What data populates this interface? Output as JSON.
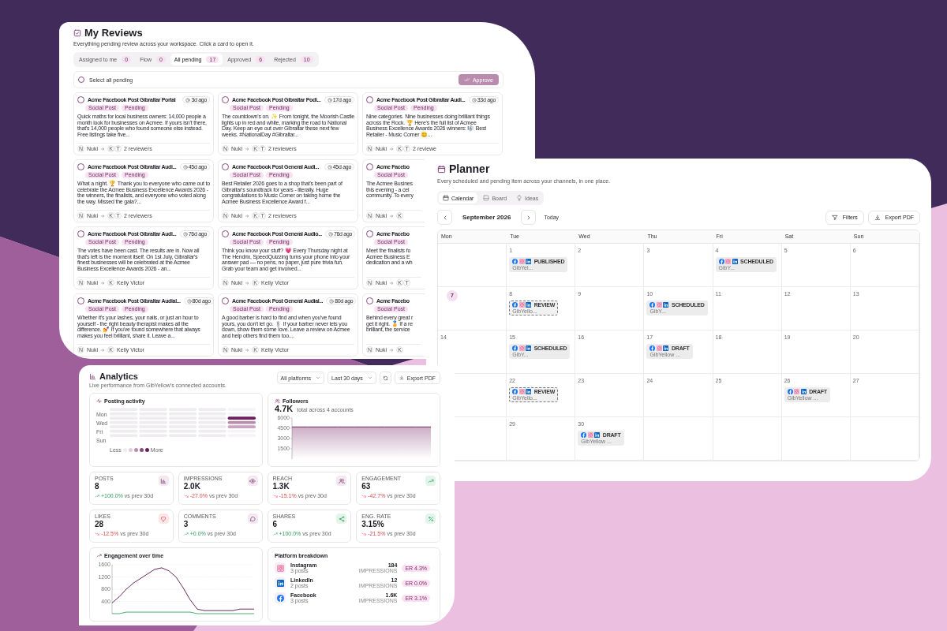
{
  "reviews": {
    "title": "My Reviews",
    "subtitle": "Everything pending review across your workspace. Click a card to open it.",
    "tabs": [
      {
        "label": "Assigned to me",
        "count": "0",
        "selected": false
      },
      {
        "label": "Flow",
        "count": "0",
        "selected": false
      },
      {
        "label": "All pending",
        "count": "17",
        "selected": true
      },
      {
        "label": "Approved",
        "count": "6",
        "selected": false
      },
      {
        "label": "Rejected",
        "count": "10",
        "selected": false
      }
    ],
    "select_all": {
      "label": "Select all pending",
      "checked": false
    },
    "approve_button": {
      "label": "Approve",
      "disabled": true
    },
    "cards": [
      {
        "title": "Acme Facebook Post Gibraltar Portal",
        "age": "3d ago",
        "tags": [
          "Social Post",
          "Pending"
        ],
        "description": "Quick maths for local business owners: 14,000 people a month look for businesses on Acmee. If yours isn't there, that's 14,000 people who found someone else instead. Free listings take five...",
        "author": {
          "initial": "N",
          "name": "Nuki"
        },
        "reviewers": [
          "K",
          "T"
        ],
        "reviewers_label": "2 reviewers",
        "checked": false
      },
      {
        "title": "Acme Facebook Post Gibraltar Podi...",
        "age": "17d ago",
        "tags": [
          "Social Post",
          "Pending"
        ],
        "description": "The countdown's on. ✨ From tonight, the Moorish Castle lights up in red and white, marking the road to National Day. Keep an eye out over Gibraltar these next few weeks. #NationalDay #Gibraltar...",
        "author": {
          "initial": "N",
          "name": "Nuki"
        },
        "reviewers": [
          "K",
          "T"
        ],
        "reviewers_label": "2 reviewers",
        "checked": false
      },
      {
        "title": "Acme Facebook Post Gibraltar Audi...",
        "age": "33d ago",
        "tags": [
          "Social Post",
          "Pending"
        ],
        "description": "Nine categories. Nine businesses doing brilliant things across the Rock. 🏆 Here's the full list of Acmee Business Excellence Awards 2026 winners: 🎼 Best Retailer - Music Corner 😊...",
        "author": {
          "initial": "N",
          "name": "Nuki"
        },
        "reviewers": [
          "K",
          "T"
        ],
        "reviewers_label": "2 reviewe",
        "checked": false
      },
      {
        "title": "Acme Facebook Post Gibraltar Audi...",
        "age": "45d ago",
        "tags": [
          "Social Post",
          "Pending"
        ],
        "description": "What a night. 🏆 Thank you to everyone who came out to celebrate the Acmee Business Excellence Awards 2026 - the winners, the finalists, and everyone who voted along the way. Missed the gala?...",
        "author": {
          "initial": "N",
          "name": "Nuki"
        },
        "reviewers": [
          "K",
          "T"
        ],
        "reviewers_label": "2 reviewers",
        "checked": false
      },
      {
        "title": "Acme Facebook Post General Audi...",
        "age": "45d ago",
        "tags": [
          "Social Post",
          "Pending"
        ],
        "description": "Best Retailer 2026 goes to a shop that's been part of Gibraltar's soundtrack for years - literally. Huge congratulations to Music Corner on taking home the Acmee Business Excellence Award f...",
        "author": {
          "initial": "N",
          "name": "Nuki"
        },
        "reviewers": [
          "K",
          "T"
        ],
        "reviewers_label": "2 reviewers",
        "checked": false
      },
      {
        "title": "Acme Facebo",
        "tags": [
          "Social Post"
        ],
        "description": "The Acmee Busines\nthis evening - a cel\ncommunity. To every",
        "author": {
          "initial": "N",
          "name": "Nuki"
        },
        "reviewers": [
          "K"
        ],
        "checked": false
      },
      {
        "title": "Acme Facebook Post Gibraltar Audi...",
        "age": "76d ago",
        "tags": [
          "Social Post",
          "Pending"
        ],
        "description": "The votes have been cast. The results are in. Now all that's left is the moment itself. On 1st July, Gibraltar's finest businesses will be celebrated at the Acmee Business Excellence Awards 2026 - an...",
        "author": {
          "initial": "N",
          "name": "Nuki"
        },
        "reviewers": [
          "K"
        ],
        "reviewers_label": "Kelly Victor",
        "checked": false
      },
      {
        "title": "Acme Facebook Post General Audio...",
        "age": "76d ago",
        "tags": [
          "Social Post",
          "Pending"
        ],
        "description": "Think you know your stuff? 💗 Every Thursday night at The Hendrix, SpeedQuizzing turns your phone into your answer pad — no pens, no paper, just pure trivia fun. Grab your team and get involved...",
        "author": {
          "initial": "N",
          "name": "Nuki"
        },
        "reviewers": [
          "K"
        ],
        "reviewers_label": "Kelly Victor",
        "checked": false
      },
      {
        "title": "Acme Facebo",
        "tags": [
          "Social Post"
        ],
        "description": "Meet the finalists fo\nAcmee Business E\ndedication and a wh",
        "author": {
          "initial": "N",
          "name": "Nuki"
        },
        "reviewers": [
          "K",
          "T"
        ],
        "checked": false
      },
      {
        "title": "Acme Facebook Post Gibraltar Audial...",
        "age": "80d ago",
        "tags": [
          "Social Post",
          "Pending"
        ],
        "description": "Whether it's your lashes, your nails, or just an hour to yourself - the right beauty therapist makes all the difference. 💅 If you've found somewhere that always makes you feel brilliant, share it. Leave a...",
        "author": {
          "initial": "N",
          "name": "Nuki"
        },
        "reviewers": [
          "K"
        ],
        "reviewers_label": "Kelly Victor",
        "checked": false
      },
      {
        "title": "Acme Facebook Post General Audial...",
        "age": "80d ago",
        "tags": [
          "Social Post",
          "Pending"
        ],
        "description": "A good barber is hard to find and when you've found yours, you don't let go. 💈 If your barber never lets you down, show them some love. Leave a review on Acmee and help others find them too....",
        "author": {
          "initial": "N",
          "name": "Nuki"
        },
        "reviewers": [
          "K"
        ],
        "reviewers_label": "Kelly Victor",
        "checked": false
      },
      {
        "title": "Acme Facebo",
        "tags": [
          "Social Post"
        ],
        "description": "Behind every great r\nget it right. 🏅 If a re\nbrilliant, the service",
        "author": {
          "initial": "N",
          "name": "Nuki"
        },
        "reviewers": [
          "K"
        ],
        "checked": false
      }
    ]
  },
  "planner": {
    "title": "Planner",
    "subtitle": "Every scheduled and pending item across your channels, in one place.",
    "views": [
      {
        "label": "Calendar",
        "selected": true
      },
      {
        "label": "Board",
        "selected": false
      },
      {
        "label": "Ideas",
        "selected": false
      }
    ],
    "month": "September 2026",
    "today_button": "Today",
    "filters_button": "Filters",
    "export_button": "Export PDF",
    "weekdays": [
      "Mon",
      "Tue",
      "Wed",
      "Thu",
      "Fri",
      "Sat",
      "Sun"
    ],
    "cells": [
      {
        "kind": "blank"
      },
      {
        "kind": "day",
        "date": "1",
        "today": false,
        "events": [
          {
            "kind": "normal",
            "platforms": [
              {
                "kind": "facebook"
              },
              {
                "kind": "instagram"
              },
              {
                "kind": "linkedin"
              }
            ],
            "status": "PUBLISHED",
            "title": "GibYel..."
          }
        ]
      },
      {
        "kind": "day",
        "date": "2",
        "today": false
      },
      {
        "kind": "day",
        "date": "3",
        "today": false
      },
      {
        "kind": "day",
        "date": "4",
        "today": false,
        "events": [
          {
            "kind": "normal",
            "platforms": [
              {
                "kind": "facebook"
              },
              {
                "kind": "instagram"
              },
              {
                "kind": "linkedin"
              }
            ],
            "status": "SCHEDULED",
            "title": "GibY..."
          }
        ]
      },
      {
        "kind": "day",
        "date": "5",
        "today": false
      },
      {
        "kind": "day",
        "date": "6",
        "today": false
      },
      {
        "kind": "day",
        "date": "7",
        "today": true
      },
      {
        "kind": "day",
        "date": "8",
        "today": false,
        "events": [
          {
            "kind": "review",
            "platforms": [
              {
                "kind": "facebook"
              },
              {
                "kind": "instagram"
              },
              {
                "kind": "linkedin"
              }
            ],
            "status": "REVIEW",
            "title": "GibYello..."
          }
        ]
      },
      {
        "kind": "day",
        "date": "9",
        "today": false
      },
      {
        "kind": "day",
        "date": "10",
        "today": false,
        "events": [
          {
            "kind": "normal",
            "platforms": [
              {
                "kind": "facebook"
              },
              {
                "kind": "instagram"
              },
              {
                "kind": "linkedin"
              }
            ],
            "status": "SCHEDULED",
            "title": "GibY..."
          }
        ]
      },
      {
        "kind": "day",
        "date": "11",
        "today": false
      },
      {
        "kind": "day",
        "date": "12",
        "today": false
      },
      {
        "kind": "day",
        "date": "13",
        "today": false
      },
      {
        "kind": "day",
        "date": "14",
        "today": false
      },
      {
        "kind": "day",
        "date": "15",
        "today": false,
        "events": [
          {
            "kind": "normal",
            "platforms": [
              {
                "kind": "facebook"
              },
              {
                "kind": "instagram"
              },
              {
                "kind": "linkedin"
              }
            ],
            "status": "SCHEDULED",
            "title": "GibY..."
          }
        ]
      },
      {
        "kind": "day",
        "date": "16",
        "today": false
      },
      {
        "kind": "day",
        "date": "17",
        "today": false,
        "events": [
          {
            "kind": "normal",
            "platforms": [
              {
                "kind": "facebook"
              },
              {
                "kind": "instagram"
              },
              {
                "kind": "linkedin"
              }
            ],
            "status": "DRAFT",
            "title": "GibYellow ..."
          }
        ]
      },
      {
        "kind": "day",
        "date": "18",
        "today": false
      },
      {
        "kind": "day",
        "date": "19",
        "today": false
      },
      {
        "kind": "day",
        "date": "20",
        "today": false
      },
      {
        "kind": "blank"
      },
      {
        "kind": "day",
        "date": "22",
        "today": false,
        "events": [
          {
            "kind": "review",
            "platforms": [
              {
                "kind": "facebook"
              },
              {
                "kind": "instagram"
              },
              {
                "kind": "linkedin"
              }
            ],
            "status": "REVIEW",
            "title": "GibYello..."
          }
        ]
      },
      {
        "kind": "day",
        "date": "23",
        "today": false
      },
      {
        "kind": "day",
        "date": "24",
        "today": false
      },
      {
        "kind": "day",
        "date": "25",
        "today": false
      },
      {
        "kind": "day",
        "date": "26",
        "today": false,
        "events": [
          {
            "kind": "normal",
            "platforms": [
              {
                "kind": "facebook"
              },
              {
                "kind": "instagram"
              },
              {
                "kind": "linkedin"
              }
            ],
            "status": "DRAFT",
            "title": "GibYellow ..."
          }
        ]
      },
      {
        "kind": "day",
        "date": "27",
        "today": false
      },
      {
        "kind": "blank"
      },
      {
        "kind": "day",
        "date": "29",
        "today": false
      },
      {
        "kind": "day",
        "date": "30",
        "today": false,
        "events": [
          {
            "kind": "normal",
            "platforms": [
              {
                "kind": "facebook"
              },
              {
                "kind": "instagram"
              },
              {
                "kind": "linkedin"
              }
            ],
            "status": "DRAFT",
            "title": "GibYellow ..."
          }
        ]
      },
      {
        "kind": "blank"
      },
      {
        "kind": "blank"
      },
      {
        "kind": "blank"
      },
      {
        "kind": "blank"
      }
    ]
  },
  "analytics": {
    "title": "Analytics",
    "subtitle": "Live performance from GibYellow's connected accounts.",
    "platform_filter": "All platforms",
    "period_filter": "Last 30 days",
    "export_button": "Export PDF",
    "posting_activity": {
      "title": "Posting activity",
      "day_labels": [
        "Mon",
        "Wed",
        "Fri",
        "Sun"
      ],
      "legend_less": "Less",
      "legend_more": "More"
    },
    "followers": {
      "title": "Followers",
      "value": "4.7K",
      "caption": "total across 4 accounts",
      "chart_data": {
        "type": "area",
        "ylim": [
          0,
          6000
        ],
        "yticks": [
          1500,
          3000,
          4500,
          6000
        ],
        "categories": [
          null,
          null,
          null,
          null,
          null,
          null,
          null,
          null,
          null,
          null
        ],
        "series": [
          {
            "color": "#6b2a5e",
            "values": [
              4700,
              4700,
              4700,
              4700,
              4700,
              4700,
              4700,
              4700,
              4700,
              4700
            ]
          }
        ]
      }
    },
    "stats": [
      {
        "label": "POSTS",
        "value": "8",
        "delta": "+100.0%",
        "trend_up": true,
        "comparison": "vs prev 30d"
      },
      {
        "label": "IMPRESSIONS",
        "value": "2.0K",
        "delta": "-27.0%",
        "trend_up": false,
        "comparison": "vs prev 30d"
      },
      {
        "label": "REACH",
        "value": "1.3K",
        "delta": "-15.1%",
        "trend_up": false,
        "comparison": "vs prev 30d"
      },
      {
        "label": "ENGAGEMENT",
        "value": "63",
        "delta": "-42.7%",
        "trend_up": false,
        "comparison": "vs prev 30d"
      },
      {
        "label": "LIKES",
        "value": "28",
        "delta": "-12.5%",
        "trend_up": false,
        "comparison": "vs prev 30d"
      },
      {
        "label": "COMMENTS",
        "value": "3",
        "delta": "+0.0%",
        "trend_up": true,
        "comparison": "vs prev 30d"
      },
      {
        "label": "SHARES",
        "value": "6",
        "delta": "+100.0%",
        "trend_up": true,
        "comparison": "vs prev 30d"
      },
      {
        "label": "ENG. RATE",
        "value": "3.15%",
        "delta": "-21.5%",
        "trend_up": false,
        "comparison": "vs prev 30d"
      }
    ],
    "engagement": {
      "title": "Engagement over time",
      "chart_data": {
        "type": "line",
        "ylim": [
          0,
          1600
        ],
        "yticks": [
          400,
          800,
          1200,
          1600
        ],
        "grid": true,
        "categories": [
          null,
          null,
          null,
          null,
          null,
          null,
          null,
          null,
          null,
          null,
          null,
          null,
          null,
          null,
          null,
          null,
          null,
          null,
          null,
          null,
          null
        ],
        "series": [
          {
            "color": "#6b2a5e",
            "values": [
              350,
              550,
              800,
              1000,
              1150,
              1300,
              1450,
              1500,
              1400,
              1200,
              850,
              450,
              150,
              100,
              100,
              100,
              100,
              100,
              150,
              150,
              150
            ]
          },
          {
            "color": "#4caf7a",
            "values": [
              0,
              0,
              50,
              50,
              50,
              50,
              50,
              50,
              50,
              50,
              50,
              50,
              0,
              0,
              0,
              0,
              0,
              0,
              0,
              0,
              0
            ]
          }
        ]
      }
    },
    "platforms": {
      "title": "Platform breakdown",
      "items": [
        {
          "kind": "instagram",
          "name": "Instagram",
          "posts": "3 posts",
          "value": "184",
          "unit": "IMPRESSIONS",
          "rate": "ER 4.3%"
        },
        {
          "kind": "linkedin",
          "name": "LinkedIn",
          "posts": "2 posts",
          "value": "12",
          "unit": "IMPRESSIONS",
          "rate": "ER 0.0%"
        },
        {
          "kind": "facebook",
          "name": "Facebook",
          "posts": "3 posts",
          "value": "1.6K",
          "unit": "IMPRESSIONS",
          "rate": "ER 3.1%"
        }
      ]
    }
  }
}
